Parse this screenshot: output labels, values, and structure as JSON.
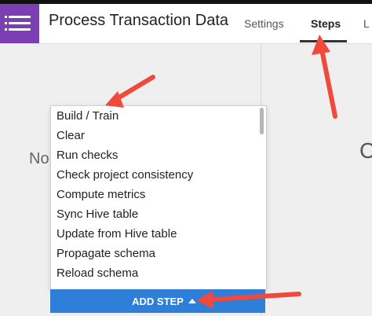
{
  "header": {
    "title": "Process Transaction Data",
    "tabs": [
      {
        "label": "Settings"
      },
      {
        "label": "Steps"
      },
      {
        "label": "L"
      }
    ]
  },
  "background": {
    "left_text": "No",
    "right_text": "C"
  },
  "menu": {
    "items": [
      {
        "label": "Build / Train"
      },
      {
        "label": "Clear"
      },
      {
        "label": "Run checks"
      },
      {
        "label": "Check project consistency"
      },
      {
        "label": "Compute metrics"
      },
      {
        "label": "Sync Hive table"
      },
      {
        "label": "Update from Hive table"
      },
      {
        "label": "Propagate schema"
      },
      {
        "label": "Reload schema"
      }
    ]
  },
  "footer": {
    "add_step_label": "ADD STEP"
  },
  "colors": {
    "app_icon": "#7b3fb3",
    "add_step": "#2f7ed8",
    "annotation_arrow": "#ef4a3c"
  },
  "icons": {
    "app": "menu-list-icon",
    "caret": "caret-up-icon"
  }
}
